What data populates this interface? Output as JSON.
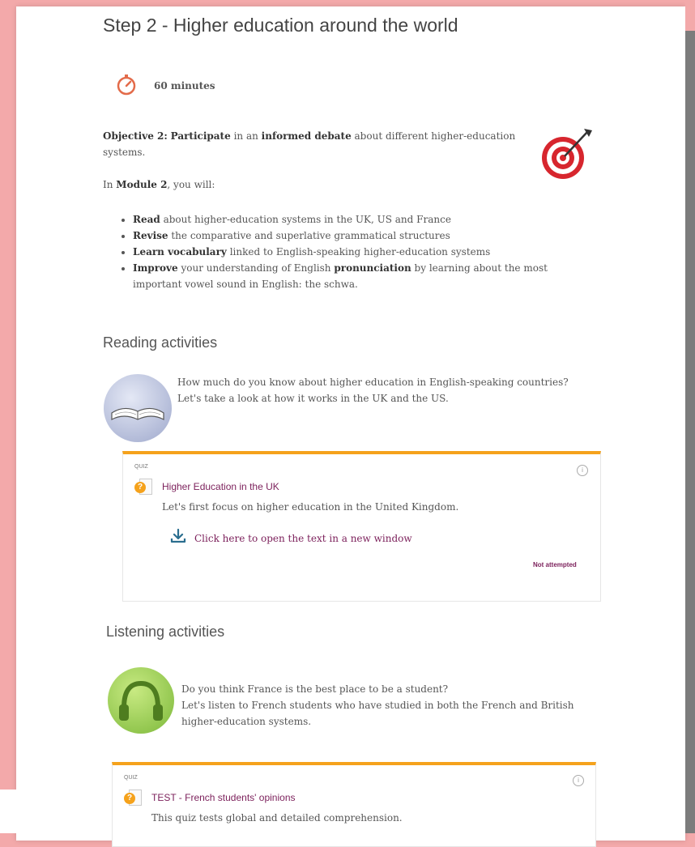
{
  "step": {
    "title": "Step 2 - Higher education around the world",
    "duration": "60 minutes"
  },
  "objective": {
    "label": "Objective 2:",
    "verb": "Participate",
    "mid": "in an",
    "emph": "informed debate",
    "rest": "about different higher-education systems."
  },
  "module_intro": {
    "pre": "In",
    "module": "Module 2",
    "post": ", you will:"
  },
  "goals": [
    {
      "bold": "Read",
      "text": " about higher-education systems in the UK, US and France"
    },
    {
      "bold": "Revise",
      "text": " the comparative and superlative grammatical structures"
    },
    {
      "bold": "Learn vocabulary",
      "text": " linked to English-speaking higher-education systems"
    },
    {
      "bold": "Improve",
      "text": " your understanding of English ",
      "bold2": "pronunciation",
      "text2": " by learning about the most important vowel sound in English: the schwa."
    }
  ],
  "reading": {
    "heading": "Reading activities",
    "intro_line1": "How much do you know about higher education in English-speaking countries?",
    "intro_line2": "Let's take a look at how it works in the UK and the US.",
    "card": {
      "kind": "QUIZ",
      "title": "Higher Education in the UK",
      "description": "Let's first focus on higher education in the United Kingdom.",
      "link": "Click here to open the text in a new window",
      "status": "Not attempted"
    }
  },
  "listening": {
    "heading": "Listening activities",
    "intro_line1": "Do you think France is the best place to be a student?",
    "intro_line2": "Let's listen to French students who have studied in both the French and British",
    "intro_line3": "higher-education systems.",
    "card": {
      "kind": "QUIZ",
      "title": "TEST - French students' opinions",
      "description": "This quiz tests global and detailed comprehension."
    }
  },
  "colors": {
    "accent_orange": "#f5a21c",
    "link_purple": "#7b1f5a",
    "background_pink": "#f3a9aa"
  }
}
